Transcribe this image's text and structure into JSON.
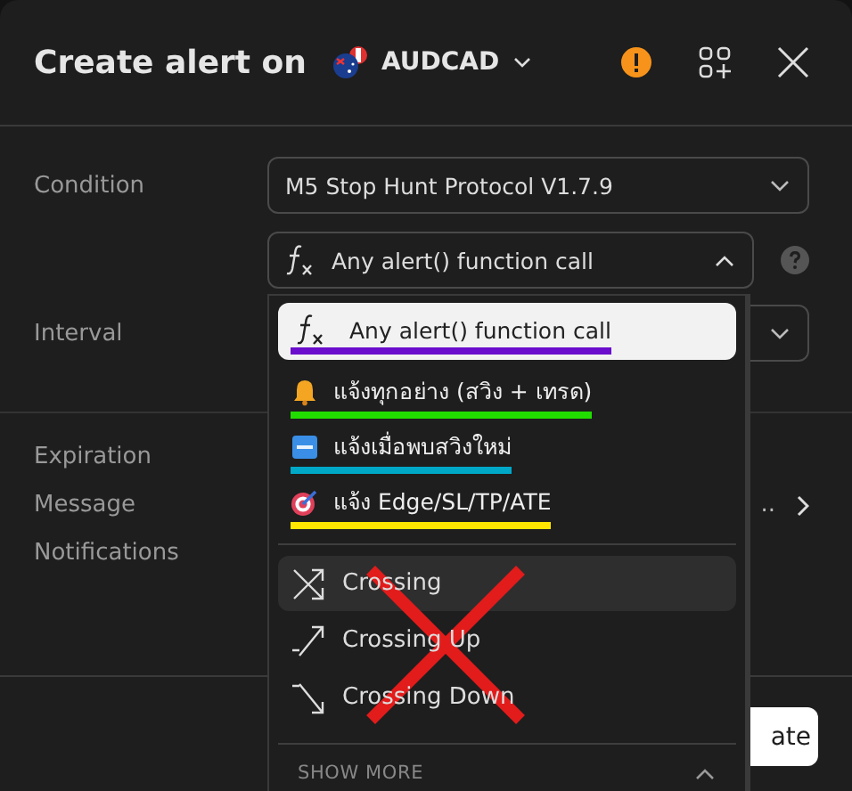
{
  "header": {
    "title": "Create alert on",
    "symbol": "AUDCAD"
  },
  "condition": {
    "label": "Condition",
    "value": "M5 Stop Hunt Protocol V1.7.9"
  },
  "alert_type": {
    "value": "Any alert() function call",
    "expanded": true
  },
  "interval": {
    "label": "Interval"
  },
  "expiration": {
    "label": "Expiration"
  },
  "message": {
    "label": "Message",
    "value": ".."
  },
  "notifications": {
    "label": "Notifications"
  },
  "dropdown": {
    "items": [
      {
        "label": "Any alert() function call",
        "kind": "function",
        "selected": true,
        "color": "#6a0dcc"
      },
      {
        "label": "แจ้งทุกอย่าง (สวิง + เทรด)",
        "kind": "bell",
        "selected": false,
        "color": "#22dd00"
      },
      {
        "label": "แจ้งเมื่อพบสวิงใหม่",
        "kind": "new",
        "selected": false,
        "color": "#00a8c8"
      },
      {
        "label": "แจ้ง Edge/SL/TP/ATE",
        "kind": "target",
        "selected": false,
        "color": "#ffe600"
      }
    ],
    "crossing_items": [
      {
        "label": "Crossing",
        "kind": "cross",
        "highlighted": true
      },
      {
        "label": "Crossing Up",
        "kind": "up",
        "highlighted": false
      },
      {
        "label": "Crossing Down",
        "kind": "down",
        "highlighted": false
      }
    ],
    "struck_out": true,
    "show_more": "SHOW MORE"
  },
  "create_button": "ate"
}
